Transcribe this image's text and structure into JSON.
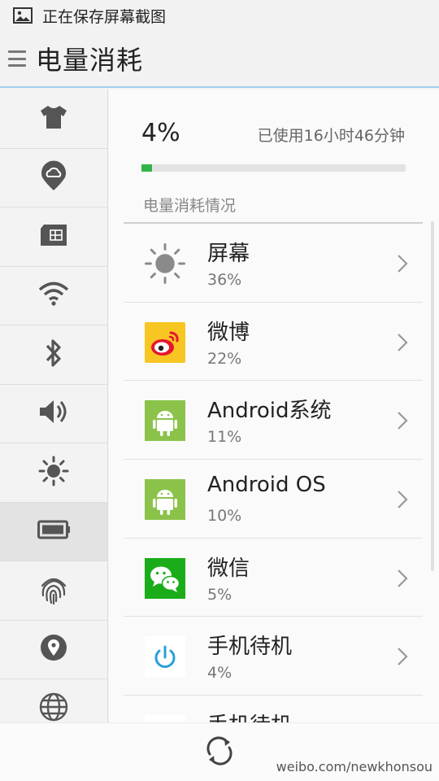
{
  "status_bar": {
    "text": "正在保存屏幕截图",
    "icon": "image-icon"
  },
  "header": {
    "title": "电量消耗",
    "menu_icon": "menu-icon"
  },
  "side_rail": {
    "items": [
      {
        "icon": "theme-shirt-icon",
        "active": false
      },
      {
        "icon": "cloud-icon",
        "active": false
      },
      {
        "icon": "sim-card-icon",
        "active": false
      },
      {
        "icon": "wifi-icon",
        "active": false
      },
      {
        "icon": "bluetooth-icon",
        "active": false
      },
      {
        "icon": "volume-icon",
        "active": false
      },
      {
        "icon": "brightness-icon",
        "active": false
      },
      {
        "icon": "battery-icon",
        "active": true
      },
      {
        "icon": "fingerprint-icon",
        "active": false
      },
      {
        "icon": "location-icon",
        "active": false
      },
      {
        "icon": "globe-icon",
        "active": false
      }
    ]
  },
  "summary": {
    "percent_text": "4%",
    "usage_text": "已使用16小时46分钟",
    "progress_fraction": 0.04,
    "progress_color": "#2fb44a"
  },
  "section": {
    "title": "电量消耗情况"
  },
  "list": [
    {
      "name": "屏幕",
      "percent": "36%",
      "icon": "sun-icon"
    },
    {
      "name": "微博",
      "percent": "22%",
      "icon": "weibo-icon"
    },
    {
      "name": "Android系统",
      "percent": "11%",
      "icon": "android-icon"
    },
    {
      "name": "Android OS",
      "percent": "10%",
      "icon": "android-icon"
    },
    {
      "name": "微信",
      "percent": "5%",
      "icon": "wechat-icon"
    },
    {
      "name": "手机待机",
      "percent": "4%",
      "icon": "power-icon"
    },
    {
      "name": "手机待机",
      "percent": "",
      "icon": "power-icon"
    }
  ],
  "bottom_bar": {
    "refresh_icon": "refresh-icon"
  },
  "watermark": "weibo.com/newkhonsou"
}
